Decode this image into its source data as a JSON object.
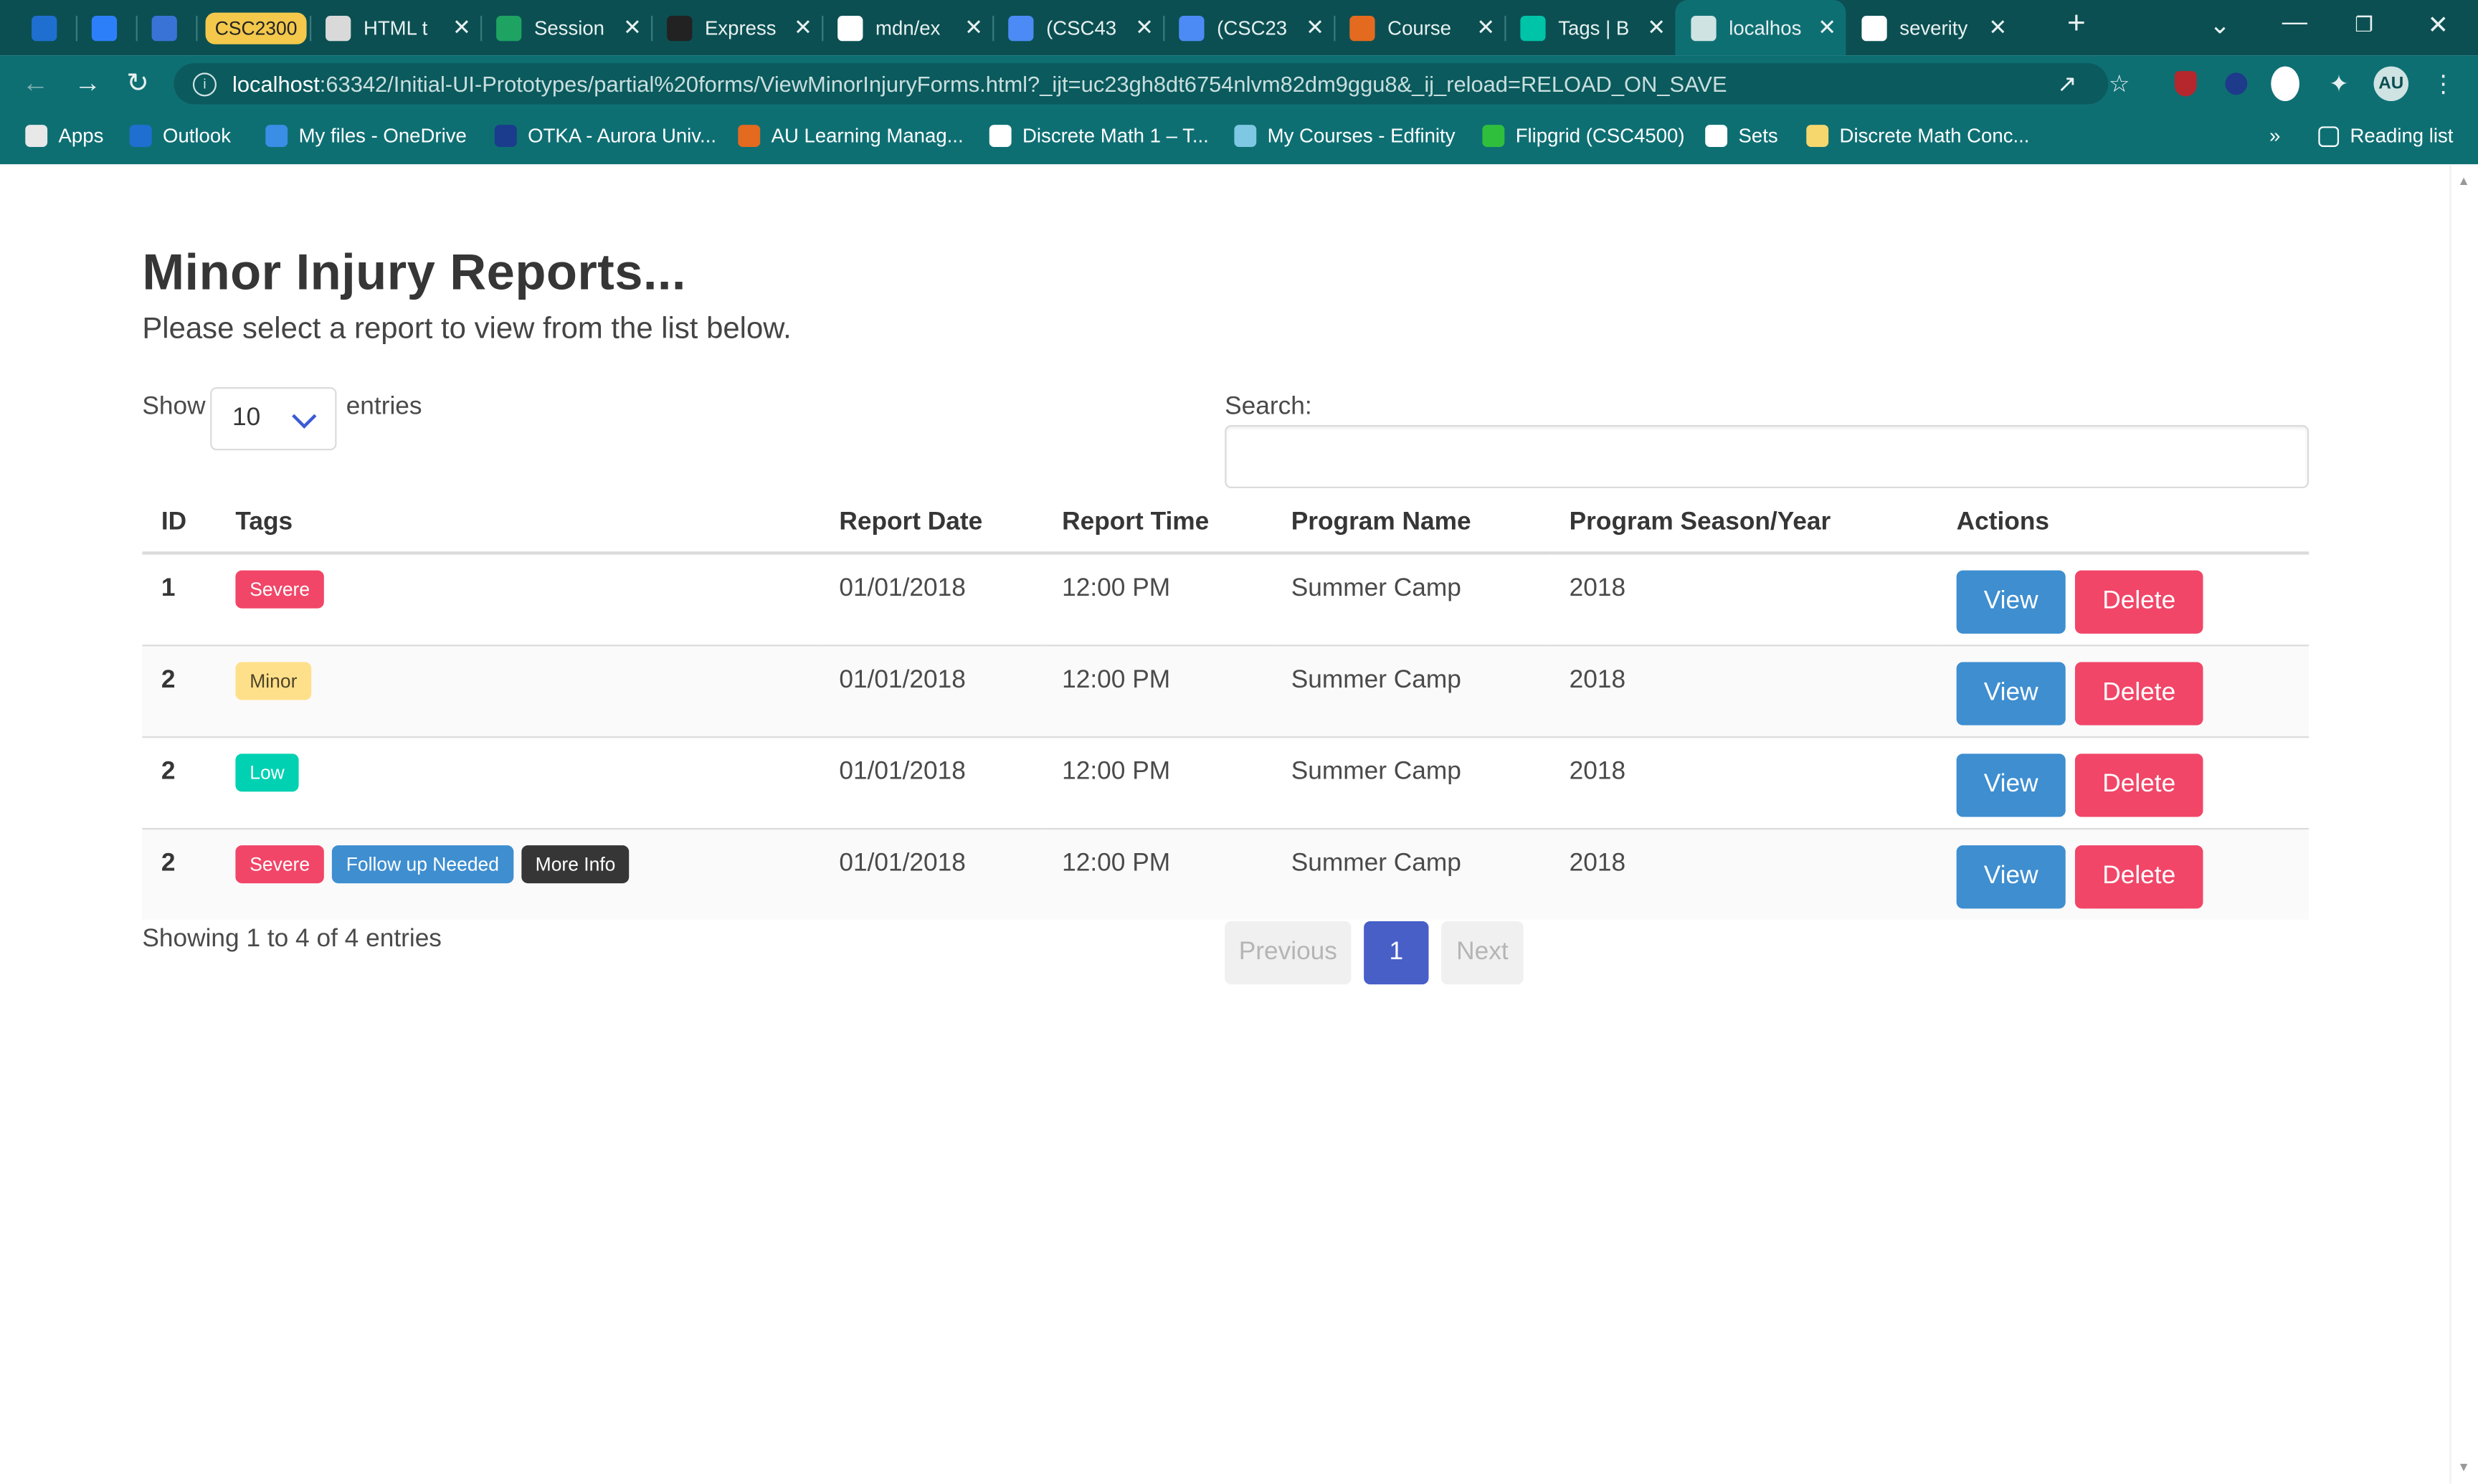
{
  "browser": {
    "tabs": [
      {
        "title": "",
        "color": "#1f6fd1"
      },
      {
        "title": "",
        "color": "#2d7ff9"
      },
      {
        "title": "",
        "color": "#3a73d6"
      },
      {
        "title": "CSC2300",
        "color": "#f3c84b"
      },
      {
        "title": "HTML t",
        "color": "#d9d9d9"
      },
      {
        "title": "Session",
        "color": "#1ea362"
      },
      {
        "title": "Express",
        "color": "#222222"
      },
      {
        "title": "mdn/ex",
        "color": "#ffffff"
      },
      {
        "title": "(CSC43",
        "color": "#4c8bf5"
      },
      {
        "title": "(CSC23",
        "color": "#4c8bf5"
      },
      {
        "title": "Course",
        "color": "#e46a1f"
      },
      {
        "title": "Tags | B",
        "color": "#00c4a7"
      },
      {
        "title": "localhos",
        "color": "#cfe3e3"
      },
      {
        "title": "severity",
        "color": "#ffffff"
      }
    ],
    "url_host": "localhost",
    "url_rest": ":63342/Initial-UI-Prototypes/partial%20forms/ViewMinorInjuryForms.html?_ijt=uc23gh8dt6754nlvm82dm9ggu8&_ij_reload=RELOAD_ON_SAVE",
    "profile_initials": "AU",
    "bookmarks": [
      {
        "label": "Apps",
        "color": "#e8e8e8"
      },
      {
        "label": "Outlook",
        "color": "#1f6fd1"
      },
      {
        "label": "My files - OneDrive",
        "color": "#3a8ee6"
      },
      {
        "label": "OTKA - Aurora Univ...",
        "color": "#1b3c8c"
      },
      {
        "label": "AU Learning Manag...",
        "color": "#e46a1f"
      },
      {
        "label": "Discrete Math 1 – T...",
        "color": "#ffffff"
      },
      {
        "label": "My Courses - Edfinity",
        "color": "#7ec8e3"
      },
      {
        "label": "Flipgrid (CSC4500)",
        "color": "#2fbf3d"
      },
      {
        "label": "Sets",
        "color": "#ffffff"
      },
      {
        "label": "Discrete Math Conc...",
        "color": "#f5d76e"
      }
    ],
    "reading_list": "Reading list",
    "more_bookmarks": "»"
  },
  "page": {
    "title": "Minor Injury Reports...",
    "subtitle": "Please select a report to view from the list below.",
    "show_label": "Show",
    "entries_label": "entries",
    "page_size": "10",
    "search_label": "Search:",
    "search_value": "",
    "columns": [
      "ID",
      "Tags",
      "Report Date",
      "Report Time",
      "Program Name",
      "Program Season/Year",
      "Actions"
    ],
    "rows": [
      {
        "id": "1",
        "tags": [
          {
            "text": "Severe",
            "kind": "danger"
          }
        ],
        "date": "01/01/2018",
        "time": "12:00 PM",
        "program": "Summer Camp",
        "season": "2018"
      },
      {
        "id": "2",
        "tags": [
          {
            "text": "Minor",
            "kind": "warning"
          }
        ],
        "date": "01/01/2018",
        "time": "12:00 PM",
        "program": "Summer Camp",
        "season": "2018"
      },
      {
        "id": "2",
        "tags": [
          {
            "text": "Low",
            "kind": "primary"
          }
        ],
        "date": "01/01/2018",
        "time": "12:00 PM",
        "program": "Summer Camp",
        "season": "2018"
      },
      {
        "id": "2",
        "tags": [
          {
            "text": "Severe",
            "kind": "danger"
          },
          {
            "text": "Follow up Needed",
            "kind": "info"
          },
          {
            "text": "More Info",
            "kind": "dark"
          }
        ],
        "date": "01/01/2018",
        "time": "12:00 PM",
        "program": "Summer Camp",
        "season": "2018"
      }
    ],
    "view_label": "View",
    "delete_label": "Delete",
    "info": "Showing 1 to 4 of 4 entries",
    "pager": {
      "previous": "Previous",
      "current": "1",
      "next": "Next"
    }
  }
}
